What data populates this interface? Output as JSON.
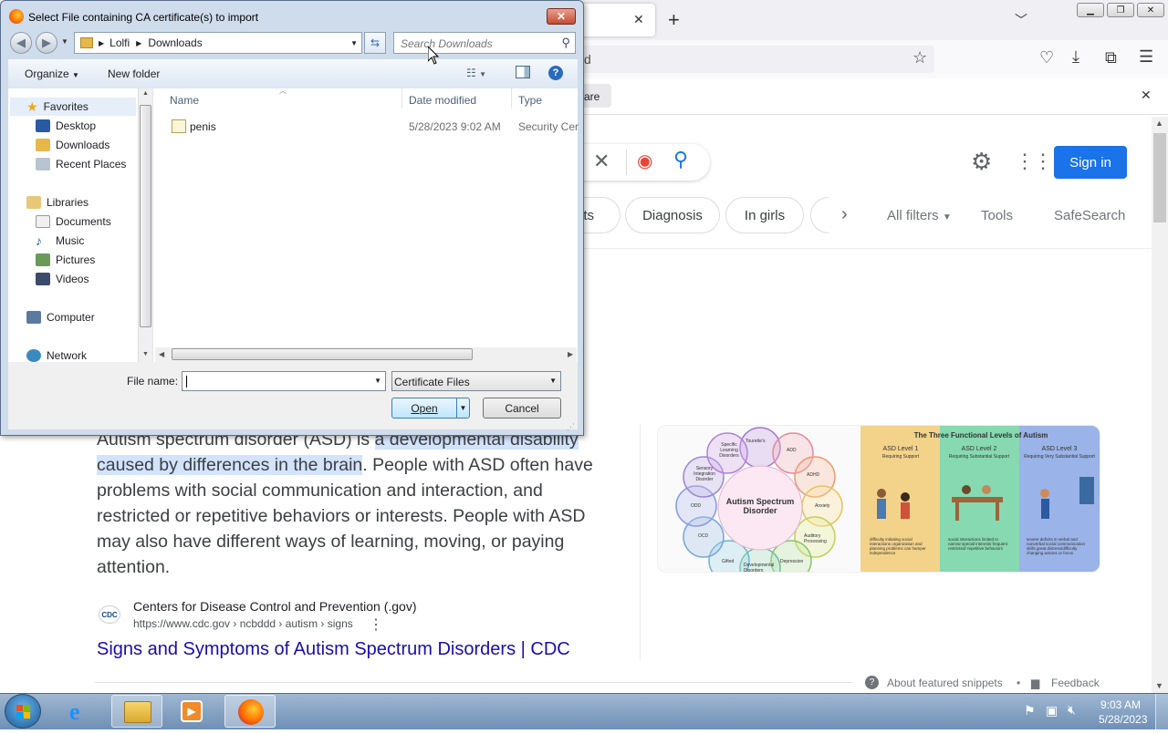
{
  "browser": {
    "new_tab": "+",
    "tab_close": "✕",
    "urlbar_text": "d",
    "notification_text": "are",
    "notification_close": "✕",
    "toolbar_icons": [
      "star-icon",
      "pocket-icon",
      "download-icon",
      "extensions-icon",
      "menu-icon"
    ]
  },
  "google": {
    "sign_in": "Sign in",
    "chips": [
      "ts",
      "Diagnosis",
      "In girls"
    ],
    "filters": {
      "all_filters": "All filters",
      "tools": "Tools",
      "safesearch": "SafeSearch"
    },
    "snippet": {
      "part1": "Autism spectrum disorder (ASD) is ",
      "highlight1": "a developmental disability",
      "highlight2": "caused by differences in the brain",
      "part2": ". People with ASD often have problems with social communication and interaction, and restricted or repetitive behaviors or interests. People with ASD may also have different ways of learning, moving, or paying attention."
    },
    "source": {
      "favicon": "CDC",
      "name": "Centers for Disease Control and Prevention (.gov)",
      "url": "https://www.cdc.gov › ncbddd › autism › signs",
      "title": "Signs and Symptoms of Autism Spectrum Disorders | CDC"
    },
    "footer": {
      "about": "About featured snippets",
      "bullet": "•",
      "feedback": "Feedback"
    },
    "image1": {
      "center": "Autism Spectrum Disorder",
      "petals": [
        "Tourette's",
        "ADD",
        "ADHD",
        "Anxiety",
        "Auditory Processing",
        "Depression",
        "Developmental Disorders",
        "Gifted",
        "OCD",
        "ODD",
        "Sensory Integration Disorder",
        "Specific Learning Disorders"
      ]
    },
    "image2": {
      "title": "The Three Functional Levels of Autism",
      "levels": [
        {
          "name": "ASD Level 1",
          "sub": "Requiring Support",
          "notes": "difficulty initiating social interactions  organization and planning problems can hamper independence"
        },
        {
          "name": "ASD Level 2",
          "sub": "Requiring Substantial Support",
          "notes": "social interactions limited to narrow special interests  frequent restricted/ repetitive behaviors"
        },
        {
          "name": "ASD Level 3",
          "sub": "Requiring Very Substantial Support",
          "notes": "severe deficits in verbal and nonverbal social communication skills  great distress/difficulty changing actions or focus"
        }
      ]
    },
    "colors": {
      "accent": "#1a73e8",
      "link": "#1a0dab",
      "highlight": "#d3e3fd"
    }
  },
  "dialog": {
    "title": "Select File containing CA certificate(s) to import",
    "close": "✕",
    "breadcrumb": [
      "Lolfi",
      "Downloads"
    ],
    "search_placeholder": "Search Downloads",
    "organize": "Organize",
    "new_folder": "New folder",
    "nav": {
      "favorites": "Favorites",
      "desktop": "Desktop",
      "downloads": "Downloads",
      "recent": "Recent Places",
      "libraries": "Libraries",
      "documents": "Documents",
      "music": "Music",
      "pictures": "Pictures",
      "videos": "Videos",
      "computer": "Computer",
      "network": "Network"
    },
    "columns": {
      "name": "Name",
      "date": "Date modified",
      "type": "Type"
    },
    "files": [
      {
        "name": "penis",
        "date": "5/28/2023 9:02 AM",
        "type": "Security Cert"
      }
    ],
    "file_name_label": "File name:",
    "file_name_value": "",
    "file_type": "Certificate Files",
    "open": "Open",
    "cancel": "Cancel"
  },
  "taskbar": {
    "time": "9:03 AM",
    "date": "5/28/2023",
    "apps": [
      "start-orb",
      "internet-explorer",
      "file-explorer",
      "media-player",
      "firefox"
    ]
  }
}
